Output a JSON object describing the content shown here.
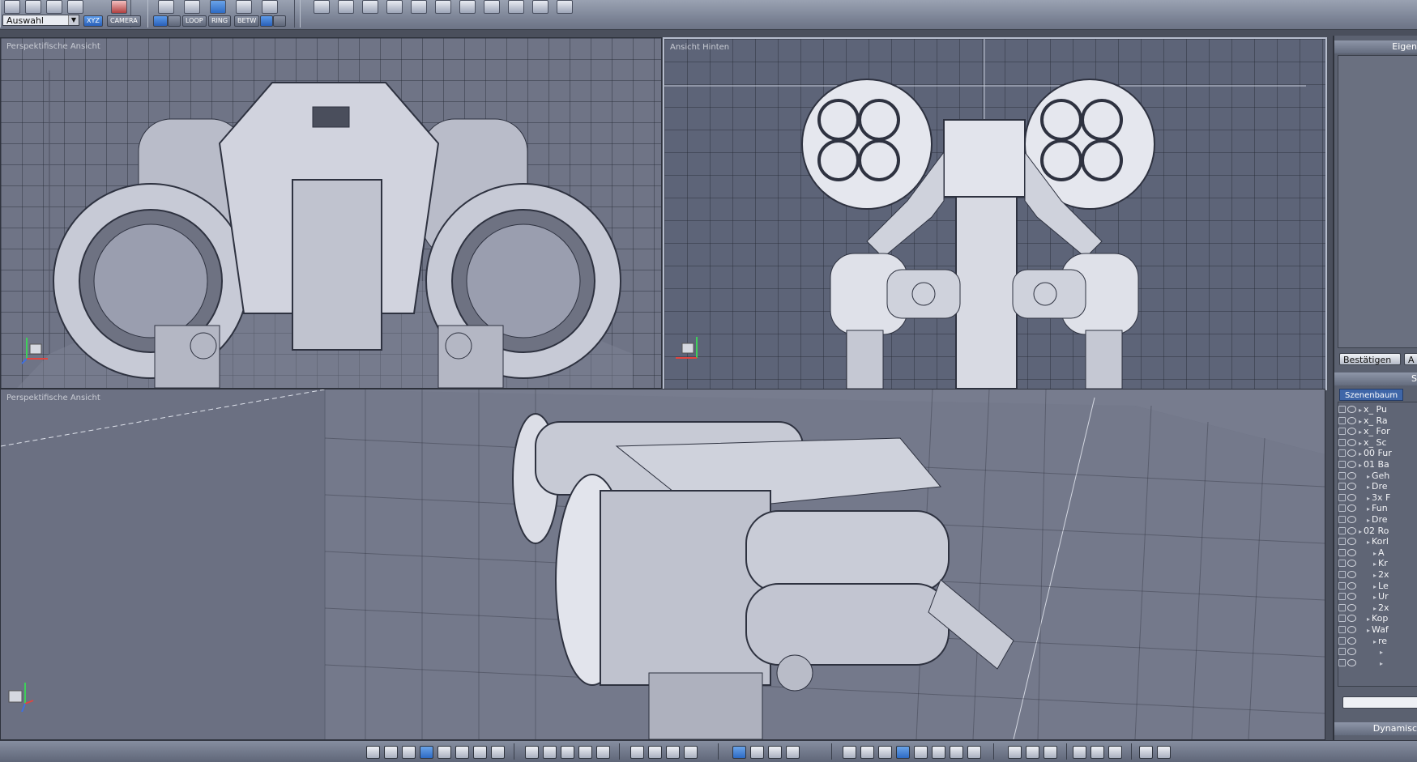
{
  "toolbar": {
    "selection_mode": "Auswahl",
    "axis_buttons": [
      "XYZ",
      "CAMERA"
    ],
    "edit_buttons": [
      "LOOP",
      "RING",
      "BETW"
    ]
  },
  "viewports": {
    "top_left": {
      "label": "Perspektifische Ansicht"
    },
    "top_right": {
      "label": "Ansicht Hinten"
    },
    "bottom": {
      "label": "Perspektifische Ansicht"
    }
  },
  "right_panel": {
    "properties_header": "Eigen",
    "confirm_button": "Bestätigen",
    "apply_button": "A",
    "second_header": "S",
    "scene_tab": "Szenenbaum",
    "tree_items": [
      "x_ Pu",
      "x_ Ra",
      "x_ For",
      "x_ Sc",
      "00 Fur",
      "01 Ba",
      "Geh",
      "Dre",
      "3x F",
      "Fun",
      "Dre",
      "02 Ro",
      "Korl",
      "A",
      "Kr",
      "2x",
      "Le",
      "Ur",
      "2x",
      "Kop",
      "Waf",
      "re",
      "",
      ""
    ],
    "dynamics_header": "Dynamisc"
  },
  "colors": {
    "viewport_bg": "#6f7486",
    "selected_blue": "#2e6bc4",
    "panel_bg": "#5b6170"
  }
}
